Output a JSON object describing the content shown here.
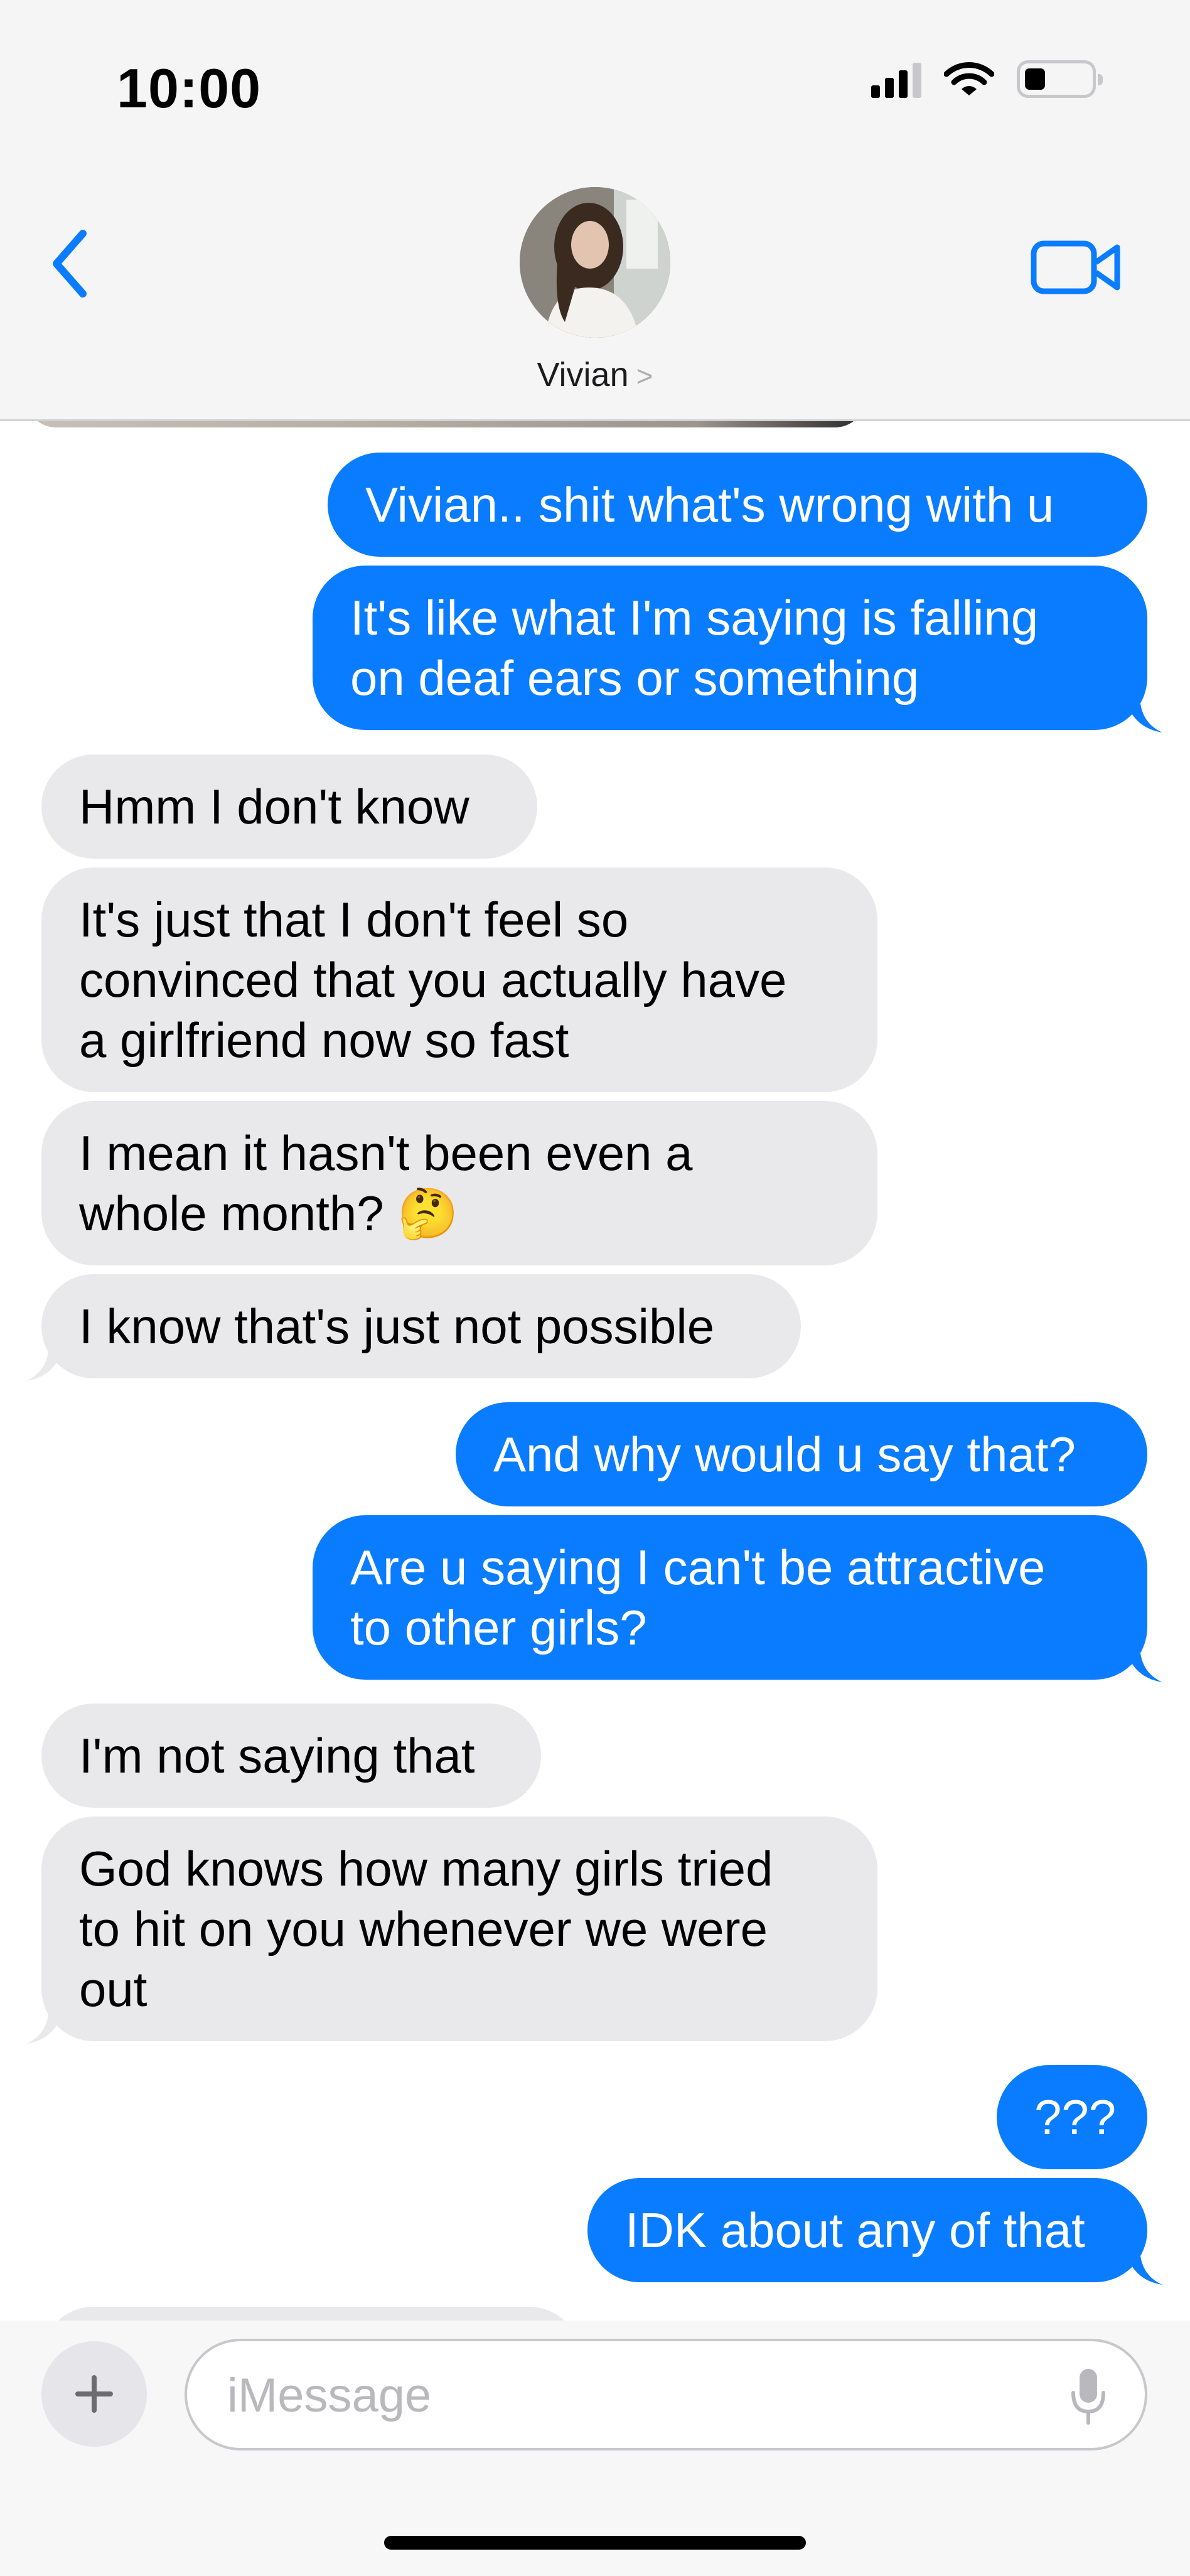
{
  "status_bar": {
    "time": "10:00",
    "icons": [
      "cellular-signal-icon",
      "wifi-icon",
      "battery-icon"
    ]
  },
  "header": {
    "contact_name": "Vivian",
    "back_icon": "chevron-left-icon",
    "facetime_icon": "video-camera-icon",
    "accent_color": "#0a7cff"
  },
  "messages": [
    {
      "from": "me",
      "text": "Vivian.. shit what's wrong with u"
    },
    {
      "from": "me",
      "text": "It's like what I'm saying is falling\non deaf ears or something"
    },
    {
      "from": "them",
      "text": "Hmm I don't know"
    },
    {
      "from": "them",
      "text": "It's just that I don't feel so\nconvinced that you actually have\na girlfriend now so fast"
    },
    {
      "from": "them",
      "text": "I mean it hasn't been even a\nwhole month? 🤔"
    },
    {
      "from": "them",
      "text": "I know that's just not possible"
    },
    {
      "from": "me",
      "text": "And why would u say that?"
    },
    {
      "from": "me",
      "text": "Are u saying I can't be attractive\nto other girls?"
    },
    {
      "from": "them",
      "text": "I'm not saying that"
    },
    {
      "from": "them",
      "text": "God knows how many girls tried\nto hit on you whenever we were\nout"
    },
    {
      "from": "me",
      "text": "???"
    },
    {
      "from": "me",
      "text": "IDK about any of that"
    }
  ],
  "input": {
    "placeholder": "iMessage"
  },
  "colors": {
    "outgoing_bubble": "#0a7cff",
    "incoming_bubble": "#e9e9eb"
  }
}
